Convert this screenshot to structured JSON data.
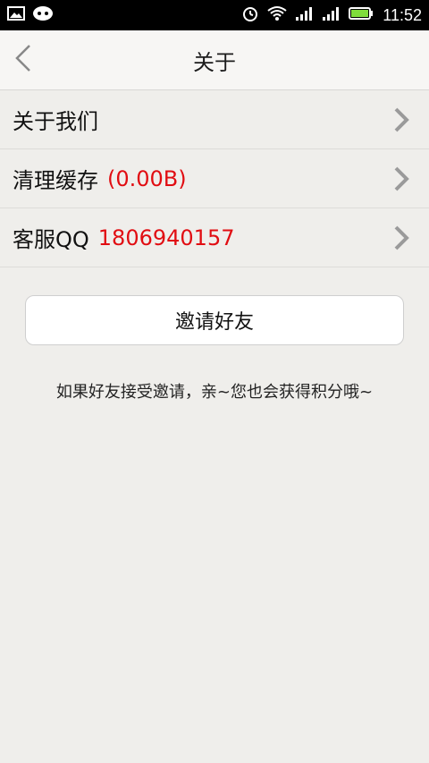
{
  "status_bar": {
    "time": "11:52",
    "left_icons": [
      "image-icon",
      "chat-icon"
    ],
    "right_icons": [
      "alarm-icon",
      "wifi-icon",
      "signal-icon",
      "signal-icon",
      "battery-icon"
    ]
  },
  "header": {
    "title": "关于",
    "back_icon": "chevron-left-icon"
  },
  "list": {
    "items": [
      {
        "label": "关于我们",
        "value": ""
      },
      {
        "label": "清理缓存",
        "value": "(0.00B)"
      },
      {
        "label": "客服QQ",
        "value": "1806940157"
      }
    ]
  },
  "invite": {
    "button_label": "邀请好友",
    "note": "如果好友接受邀请，亲~您也会获得积分哦~"
  },
  "colors": {
    "accent_red": "#e10d12",
    "background": "#efeeeb"
  }
}
